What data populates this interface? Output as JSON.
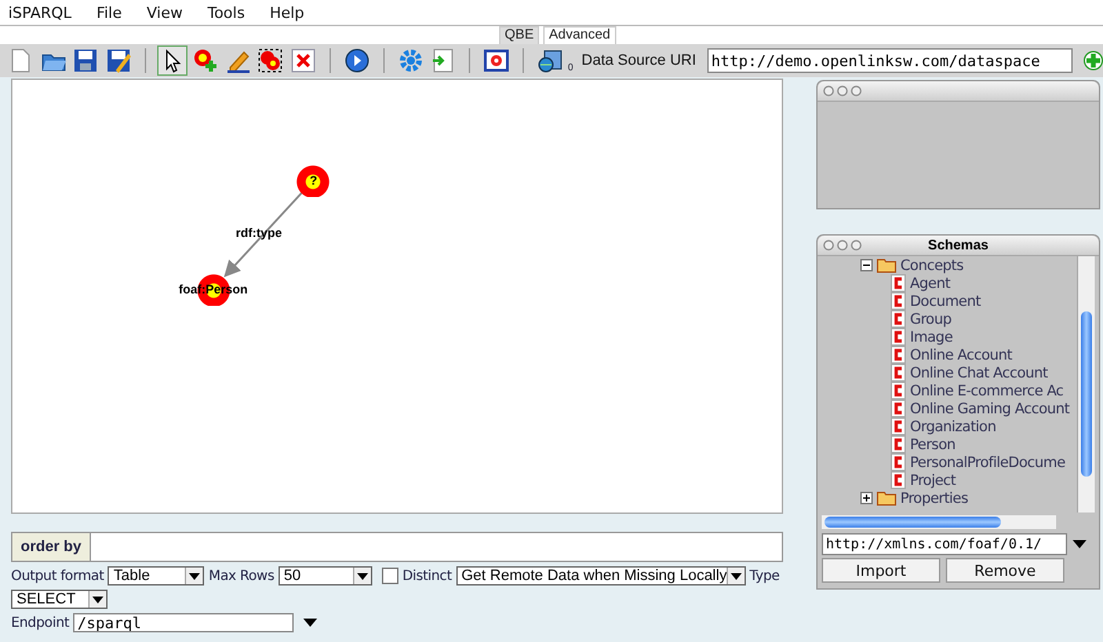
{
  "menu": [
    "iSPARQL",
    "File",
    "View",
    "Tools",
    "Help"
  ],
  "tabs": [
    {
      "label": "QBE",
      "selected": true
    },
    {
      "label": "Advanced",
      "selected": false
    }
  ],
  "toolbar": {
    "tools": [
      {
        "kind": "new",
        "selected": false
      },
      {
        "kind": "open",
        "selected": false
      },
      {
        "kind": "save",
        "selected": false
      },
      {
        "kind": "save-as",
        "selected": false
      },
      {
        "kind": "sep"
      },
      {
        "kind": "pointer",
        "selected": true
      },
      {
        "kind": "add-node",
        "selected": false
      },
      {
        "kind": "pencil",
        "selected": false
      },
      {
        "kind": "group",
        "selected": false
      },
      {
        "kind": "delete",
        "selected": false
      },
      {
        "kind": "sep"
      },
      {
        "kind": "run",
        "selected": false
      },
      {
        "kind": "sep"
      },
      {
        "kind": "gear",
        "selected": false
      },
      {
        "kind": "import",
        "selected": false
      },
      {
        "kind": "sep"
      },
      {
        "kind": "window",
        "selected": false
      },
      {
        "kind": "sep"
      },
      {
        "kind": "sources",
        "selected": false
      }
    ],
    "sources_count": "0",
    "data_source_label": "Data Source URI",
    "data_source_value": "http://demo.openlinksw.com/dataspace"
  },
  "graph": {
    "nodes": [
      {
        "label": "?"
      },
      {
        "label": "foaf:Person"
      }
    ],
    "edges": [
      {
        "label": "rdf:type"
      }
    ]
  },
  "order_by": {
    "label": "order by"
  },
  "options": {
    "output_format_label": "Output format",
    "output_format": "Table",
    "max_rows_label": "Max Rows",
    "max_rows": "50",
    "distinct_label": "Distinct",
    "distinct": false,
    "remote": "Get Remote Data when Missing Locally",
    "type_label": "Type",
    "type": "SELECT",
    "endpoint_label": "Endpoint",
    "endpoint": "/sparql"
  },
  "schemas": {
    "title": "Schemas",
    "tree": [
      {
        "label": "Concepts",
        "expanded": true,
        "children": [
          {
            "label": "Agent"
          },
          {
            "label": "Document"
          },
          {
            "label": "Group"
          },
          {
            "label": "Image"
          },
          {
            "label": "Online Account"
          },
          {
            "label": "Online Chat Account"
          },
          {
            "label": "Online E-commerce Ac"
          },
          {
            "label": "Online Gaming Account"
          },
          {
            "label": "Organization"
          },
          {
            "label": "Person"
          },
          {
            "label": "PersonalProfileDocume"
          },
          {
            "label": "Project"
          }
        ]
      },
      {
        "label": "Properties",
        "expanded": false
      }
    ],
    "uri": "http://xmlns.com/foaf/0.1/",
    "buttons": [
      "Import",
      "Remove"
    ]
  }
}
